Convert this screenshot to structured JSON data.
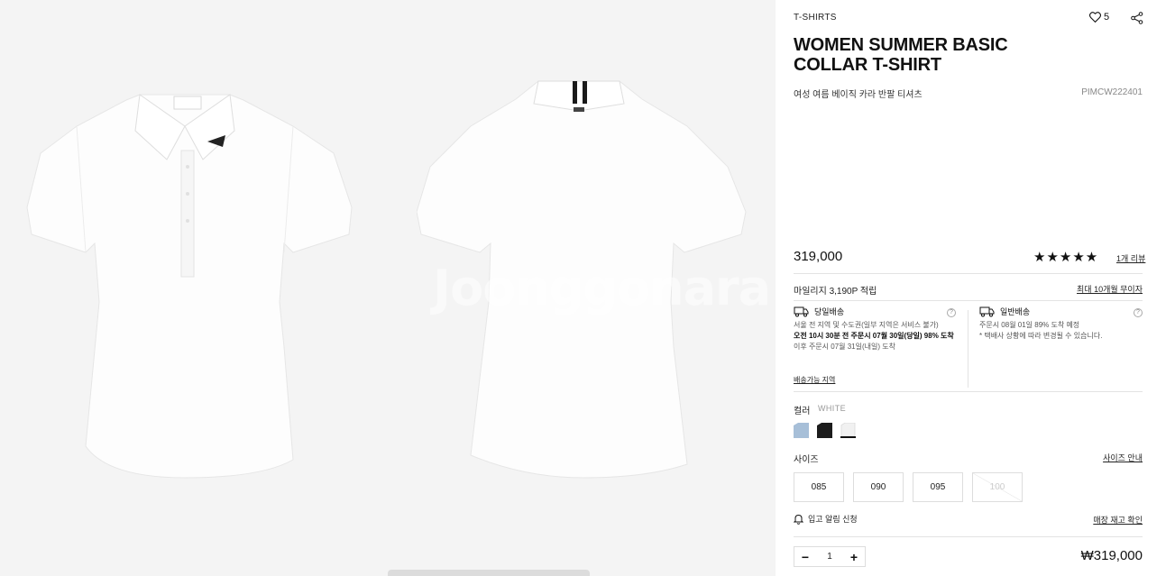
{
  "gallery": {
    "watermark": "Joonggonara"
  },
  "product": {
    "category": "T-SHIRTS",
    "wish_count": "5",
    "title_line1": "WOMEN SUMMER BASIC",
    "title_line2": "COLLAR T-SHIRT",
    "subtitle": "여성 여름 베이직 카라 반팔 티셔츠",
    "code": "PIMCW222401",
    "price": "319,000",
    "rating_stars": "★★★★★",
    "review_link": "1개 리뷰"
  },
  "benefits": {
    "mileage": "마일리지 3,190P 적립",
    "installment": "최대 10개월 무이자"
  },
  "shipping": {
    "sameday_title": "당일배송",
    "sameday_area": "서울 전 지역 및 수도권(일부 지역은 서비스 불가)",
    "sameday_promise": "오전 10시 30분 전 주문시 07월 30일(당일) 98% 도착",
    "sameday_after": "이후 주문시 07월 31일(내일) 도착",
    "normal_title": "일반배송",
    "normal_eta": "주문시 08월 01일 89% 도착 예정",
    "normal_note": "* 택배사 상황에 따라 변경될 수 있습니다.",
    "help_glyph": "?",
    "area_link": "배송가능 지역"
  },
  "color": {
    "label": "컬러",
    "selected": "WHITE",
    "swatches": [
      "#a7bfd8",
      "#1c1c1c",
      "#f1f1f1"
    ]
  },
  "size": {
    "label": "사이즈",
    "guide": "사이즈 안내",
    "options": [
      "085",
      "090",
      "095",
      "100"
    ]
  },
  "restock": {
    "label": "입고 알림 신청",
    "link": "매장 재고 확인"
  },
  "purchase": {
    "minus": "−",
    "quantity": "1",
    "plus": "+",
    "total": "₩319,000"
  }
}
